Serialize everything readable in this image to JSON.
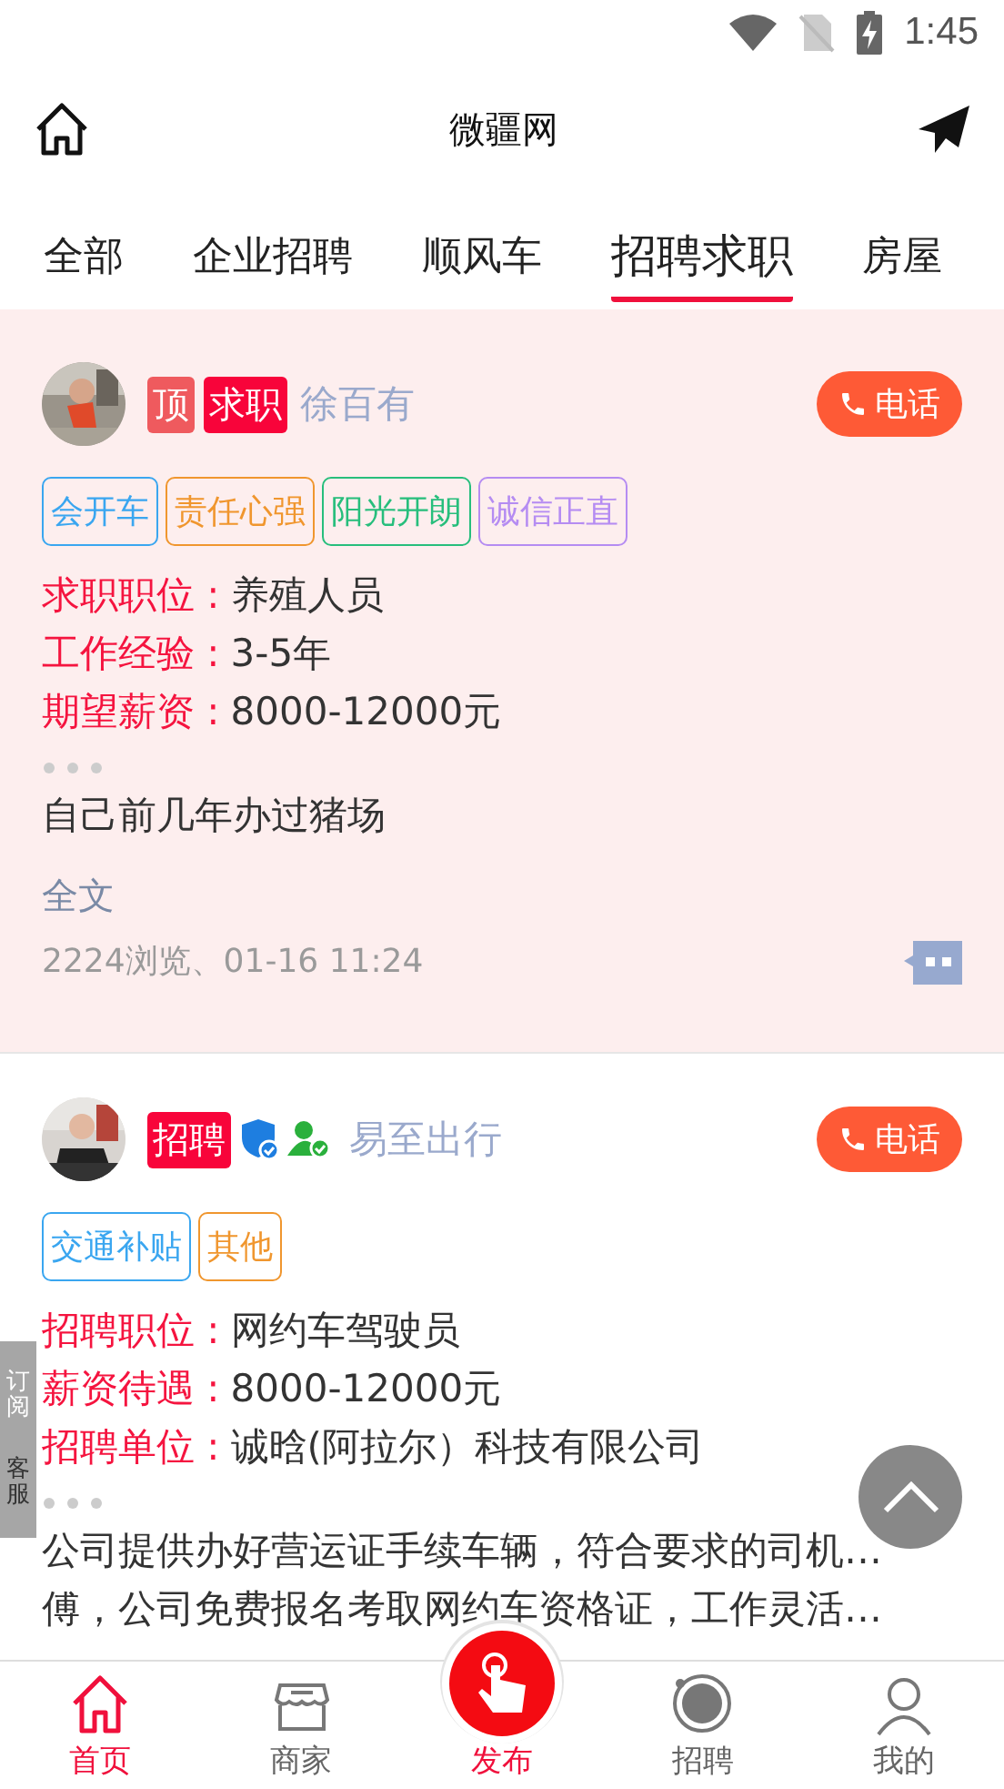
{
  "status_bar": {
    "time": "1:45"
  },
  "header": {
    "title": "微疆网"
  },
  "tabs": [
    {
      "label": "全部",
      "selected": false
    },
    {
      "label": "企业招聘",
      "selected": false
    },
    {
      "label": "顺风车",
      "selected": false
    },
    {
      "label": "招聘求职",
      "selected": true
    },
    {
      "label": "房屋",
      "selected": false
    }
  ],
  "posts": [
    {
      "highlighted": true,
      "badges": [
        {
          "text": "顶",
          "kind": "top"
        },
        {
          "text": "求职",
          "kind": "type"
        }
      ],
      "company_verified": false,
      "person_verified": false,
      "name": "徐百有",
      "call": "电话",
      "tags": [
        {
          "text": "会开车",
          "color": "#3aa6f0"
        },
        {
          "text": "责任心强",
          "color": "#f0962e"
        },
        {
          "text": "阳光开朗",
          "color": "#27be7c"
        },
        {
          "text": "诚信正直",
          "color": "#b58cf2"
        }
      ],
      "fields": [
        {
          "label": "求职职位 :",
          "value": "养殖人员"
        },
        {
          "label": "工作经验 :",
          "value": "3-5年"
        },
        {
          "label": "期望薪资 :",
          "value": "8000-12000元"
        }
      ],
      "description": [
        "自己前几年办过猪场"
      ],
      "more": "全文",
      "meta": "2224浏览、01-16 11:24"
    },
    {
      "highlighted": false,
      "badges": [
        {
          "text": "招聘",
          "kind": "type"
        }
      ],
      "company_verified": true,
      "person_verified": true,
      "name": "易至出行",
      "call": "电话",
      "tags": [
        {
          "text": "交通补贴",
          "color": "#3aa6f0"
        },
        {
          "text": "其他",
          "color": "#f0962e"
        }
      ],
      "fields": [
        {
          "label": "招聘职位 :",
          "value": "网约车驾驶员"
        },
        {
          "label": "薪资待遇 :",
          "value": "8000-12000元"
        },
        {
          "label": "招聘单位 :",
          "value": "诚晗(阿拉尔）科技有限公司"
        }
      ],
      "description": [
        "公司提供办好营运证手续车辆，符合要求的司机…",
        "傅，公司免费报名考取网约车资格证，工作灵活…"
      ]
    }
  ],
  "side_panel": [
    "订阅",
    "客服"
  ],
  "nav": [
    {
      "label": "首页",
      "kind": "home",
      "selected": true
    },
    {
      "label": "商家",
      "kind": "shop",
      "selected": false
    },
    {
      "label": "发布",
      "kind": "publish",
      "selected": true
    },
    {
      "label": "招聘",
      "kind": "hire",
      "selected": false
    },
    {
      "label": "我的",
      "kind": "user",
      "selected": false
    }
  ]
}
